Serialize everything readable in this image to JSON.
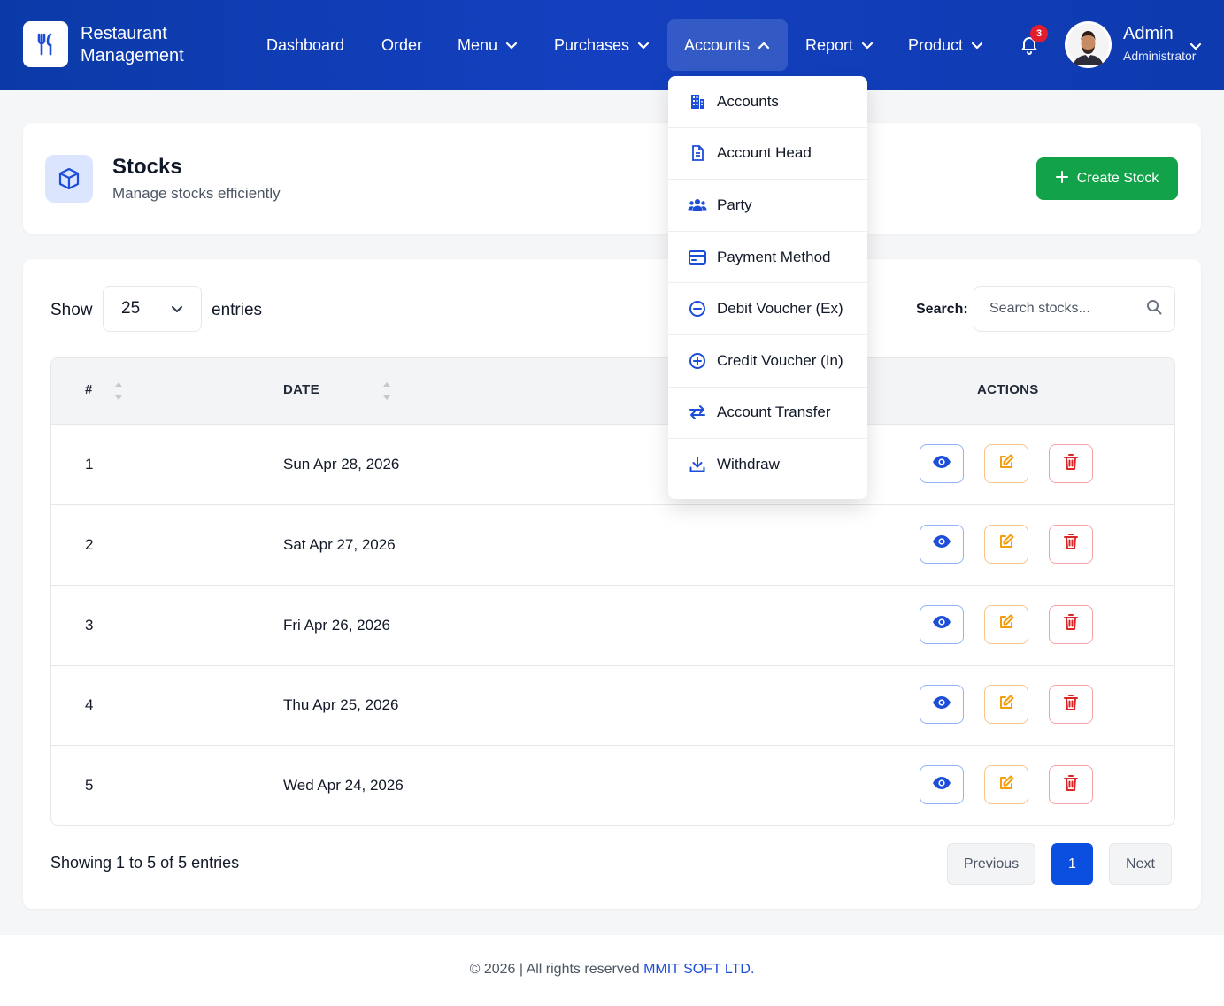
{
  "brand": {
    "line1": "Restaurant",
    "line2": "Management"
  },
  "nav": {
    "dashboard": "Dashboard",
    "order": "Order",
    "menu": "Menu",
    "purchases": "Purchases",
    "accounts": "Accounts",
    "report": "Report",
    "product": "Product"
  },
  "notifications": {
    "count": "3"
  },
  "user": {
    "name": "Admin",
    "role": "Administrator"
  },
  "accounts_menu": {
    "items": [
      {
        "label": "Accounts",
        "icon": "building-icon"
      },
      {
        "label": "Account Head",
        "icon": "document-icon"
      },
      {
        "label": "Party",
        "icon": "users-icon"
      },
      {
        "label": "Payment Method",
        "icon": "credit-card-icon"
      },
      {
        "label": "Debit Voucher (Ex)",
        "icon": "minus-circle-icon"
      },
      {
        "label": "Credit Voucher (In)",
        "icon": "plus-circle-icon"
      },
      {
        "label": "Account Transfer",
        "icon": "transfer-icon"
      },
      {
        "label": "Withdraw",
        "icon": "download-icon"
      }
    ]
  },
  "page": {
    "title": "Stocks",
    "subtitle": "Manage stocks efficiently",
    "create_label": "Create Stock"
  },
  "table_controls": {
    "show_label": "Show",
    "entries_value": "25",
    "entries_label": "entries",
    "search_label": "Search:",
    "search_placeholder": "Search stocks..."
  },
  "table": {
    "columns": {
      "num": "#",
      "date": "DATE",
      "actions": "ACTIONS"
    },
    "rows": [
      {
        "num": "1",
        "date": "Sun Apr 28, 2026"
      },
      {
        "num": "2",
        "date": "Sat Apr 27, 2026"
      },
      {
        "num": "3",
        "date": "Fri Apr 26, 2026"
      },
      {
        "num": "4",
        "date": "Thu Apr 25, 2026"
      },
      {
        "num": "5",
        "date": "Wed Apr 24, 2026"
      }
    ]
  },
  "pagination": {
    "info": "Showing 1 to 5 of 5 entries",
    "previous": "Previous",
    "current": "1",
    "next": "Next"
  },
  "footer": {
    "text": "© 2026 | All rights reserved ",
    "company": "MMIT SOFT LTD."
  },
  "colors": {
    "nav_bg": "#0b3aa8",
    "primary": "#0b4fe0",
    "success": "#12a34a",
    "view": "#1d4ed8",
    "edit": "#f59e0b",
    "delete": "#dc2626",
    "badge": "#e11d2e"
  }
}
